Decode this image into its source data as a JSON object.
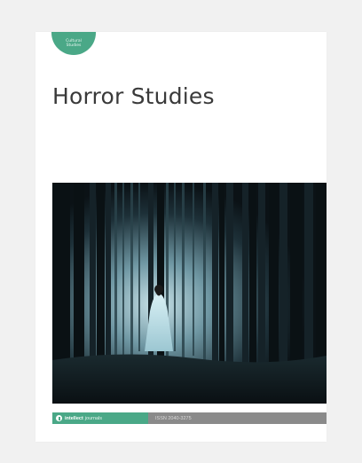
{
  "colors": {
    "badge": "#4aa887",
    "footer_left": "#4aa887",
    "footer_right": "#8a8a8a"
  },
  "badge": {
    "text": "Cultural\nStudies"
  },
  "cover": {
    "title": "Horror Studies"
  },
  "footer": {
    "imprint_icon": "intellect-logo-icon",
    "imprint_name": "intellect",
    "imprint_suffix": "journals",
    "issn": "ISSN 2040-3275"
  }
}
